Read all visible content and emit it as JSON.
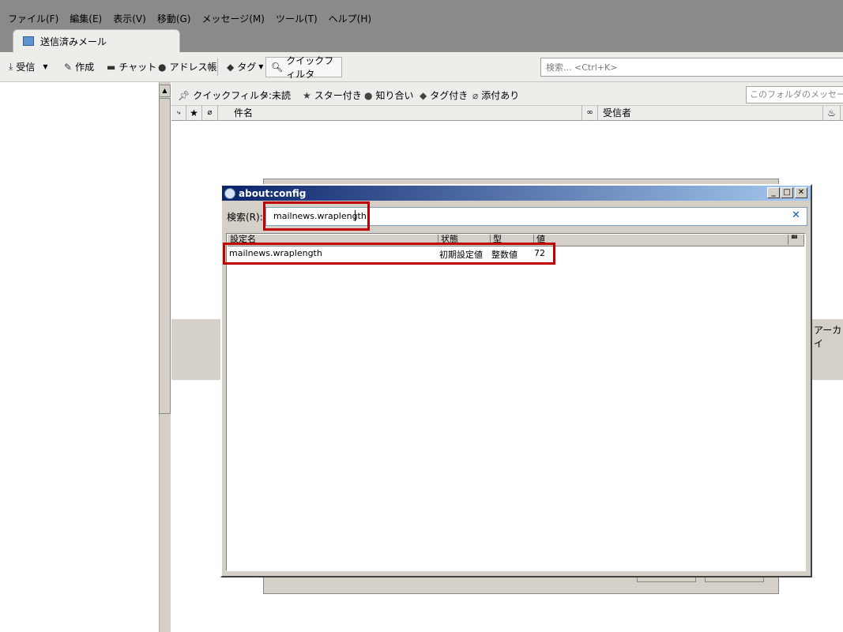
{
  "menu": [
    "ファイル(F)",
    "編集(E)",
    "表示(V)",
    "移動(G)",
    "メッセージ(M)",
    "ツール(T)",
    "ヘルプ(H)"
  ],
  "tab": {
    "title": "送信済みメール"
  },
  "toolbar": {
    "receive": "受信",
    "compose": "作成",
    "chat": "チャット",
    "addressbook": "アドレス帳",
    "tag": "タグ",
    "quickfilter": "クイックフィルタ",
    "search_placeholder": "検索... <Ctrl+K>"
  },
  "quickfilter_bar": {
    "label": "クイックフィルタ:",
    "unread": "未読",
    "starred": "スター付き",
    "contacts": "知り合い",
    "tagged": "タグ付き",
    "attachment": "添付あり",
    "filter_placeholder": "このフォルダのメッセージを"
  },
  "columns": {
    "subject": "件名",
    "recipient": "受信者"
  },
  "archive_label": "アーカイ",
  "config_window": {
    "title": "about:config",
    "search_label": "検索(R):",
    "search_value": "mailnews.wraplength",
    "headers": [
      "設定名",
      "状態",
      "型",
      "値"
    ],
    "rows": [
      {
        "name": "mailnews.wraplength",
        "status": "初期設定値",
        "type": "整数値",
        "value": "72"
      }
    ]
  },
  "colors": {
    "highlight": "#c00000",
    "titlebar": "#0a246a",
    "accent": "#1c5aa6"
  }
}
